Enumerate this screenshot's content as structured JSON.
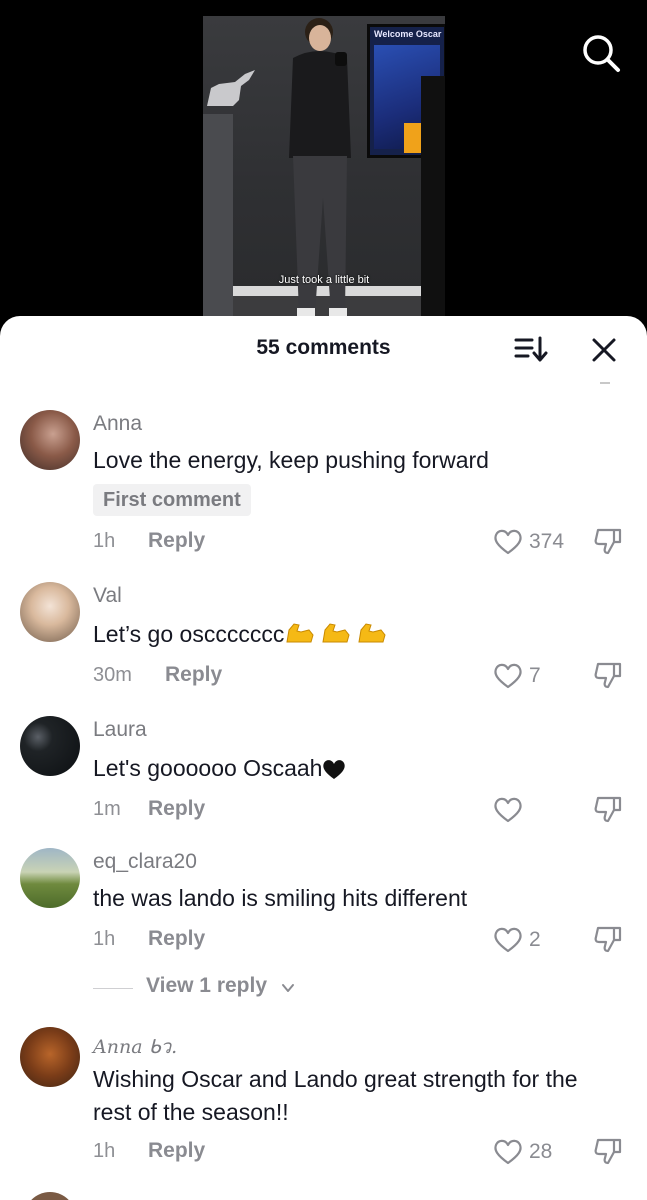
{
  "video": {
    "caption": "Just took a little bit",
    "screen_title": "Welcome Oscar"
  },
  "header": {
    "comments_count_label": "55 comments"
  },
  "comments": [
    {
      "username": "Anna",
      "text": "Love the energy, keep pushing forward",
      "badge": "First comment",
      "time": "1h",
      "reply_label": "Reply",
      "likes": "374"
    },
    {
      "username": "Val",
      "text": "Let’s go osccccccc",
      "emoji": "flexed-biceps x3",
      "time": "30m",
      "reply_label": "Reply",
      "likes": "7"
    },
    {
      "username": "Laura",
      "text": "Let's goooooo Oscaah",
      "emoji": "black-heart",
      "time": "1m",
      "reply_label": "Reply",
      "likes": ""
    },
    {
      "username": "eq_clara20",
      "text": "the was lando is smiling hits different",
      "time": "1h",
      "reply_label": "Reply",
      "likes": "2",
      "view_replies_label": "View 1 reply"
    },
    {
      "username": "Anna",
      "username_suffix": "ᑲว.",
      "text": "Wishing Oscar and Lando great strength for the rest of the season!!",
      "time": "1h",
      "reply_label": "Reply",
      "likes": "28"
    }
  ],
  "colors": {
    "text_primary": "#161823",
    "text_secondary": "#8a8b91",
    "sheet_bg": "#ffffff",
    "badge_bg": "#f1f1f2"
  }
}
